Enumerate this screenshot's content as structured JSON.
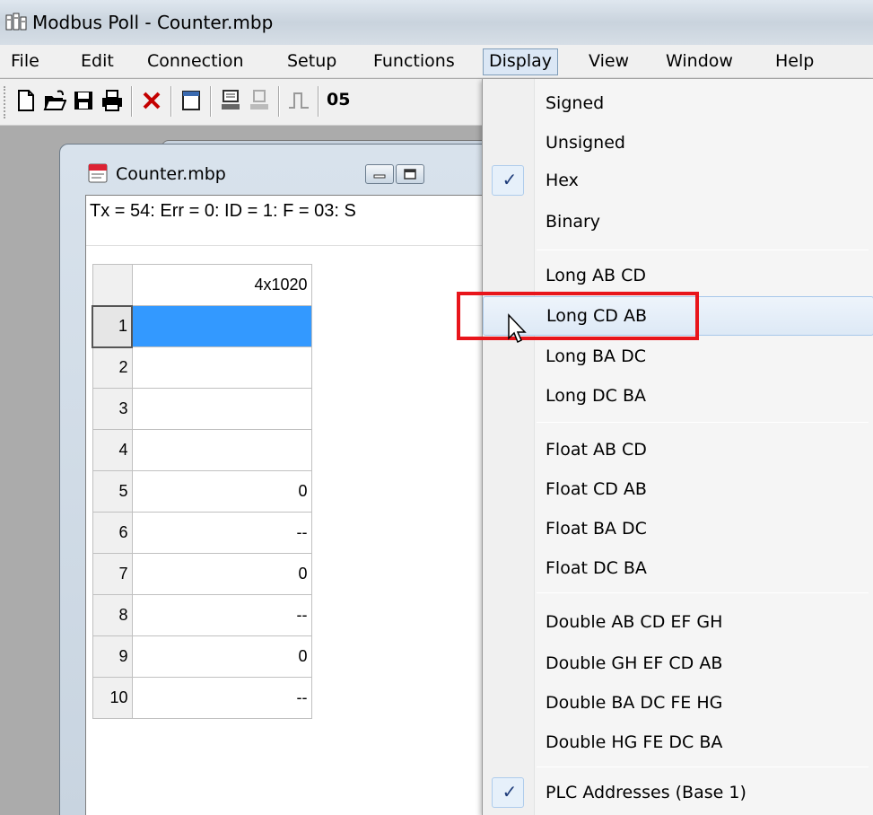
{
  "window": {
    "title": "Modbus Poll - Counter.mbp"
  },
  "menubar": {
    "items": [
      "File",
      "Edit",
      "Connection",
      "Setup",
      "Functions",
      "Display",
      "View",
      "Window",
      "Help"
    ]
  },
  "toolbar": {
    "partial_text": "05"
  },
  "child": {
    "title": "Counter.mbp",
    "status": "Tx = 54: Err = 0: ID = 1: F = 03: S",
    "column_header": "4x1020",
    "rows": [
      {
        "n": "1",
        "v": ""
      },
      {
        "n": "2",
        "v": ""
      },
      {
        "n": "3",
        "v": ""
      },
      {
        "n": "4",
        "v": ""
      },
      {
        "n": "5",
        "v": "0"
      },
      {
        "n": "6",
        "v": "--"
      },
      {
        "n": "7",
        "v": "0"
      },
      {
        "n": "8",
        "v": "--"
      },
      {
        "n": "9",
        "v": "0"
      },
      {
        "n": "10",
        "v": "--"
      }
    ]
  },
  "display_menu": {
    "items": [
      {
        "label": "Signed",
        "checked": false
      },
      {
        "label": "Unsigned",
        "checked": false
      },
      {
        "label": "Hex",
        "checked": true
      },
      {
        "label": "Binary",
        "checked": false
      },
      {
        "label": "Long AB CD",
        "checked": false
      },
      {
        "label": "Long CD AB",
        "checked": false,
        "hover": true
      },
      {
        "label": "Long BA DC",
        "checked": false
      },
      {
        "label": "Long DC BA",
        "checked": false
      },
      {
        "label": "Float AB CD",
        "checked": false
      },
      {
        "label": "Float CD AB",
        "checked": false
      },
      {
        "label": "Float BA DC",
        "checked": false
      },
      {
        "label": "Float DC BA",
        "checked": false
      },
      {
        "label": "Double AB CD EF GH",
        "checked": false
      },
      {
        "label": "Double GH EF CD AB",
        "checked": false
      },
      {
        "label": "Double BA DC FE HG",
        "checked": false
      },
      {
        "label": "Double HG FE DC BA",
        "checked": false
      },
      {
        "label": "PLC Addresses (Base 1)",
        "checked": true
      }
    ],
    "check_mark": "✓"
  },
  "colors": {
    "highlight": "#e8151b",
    "selection": "#3399ff"
  }
}
